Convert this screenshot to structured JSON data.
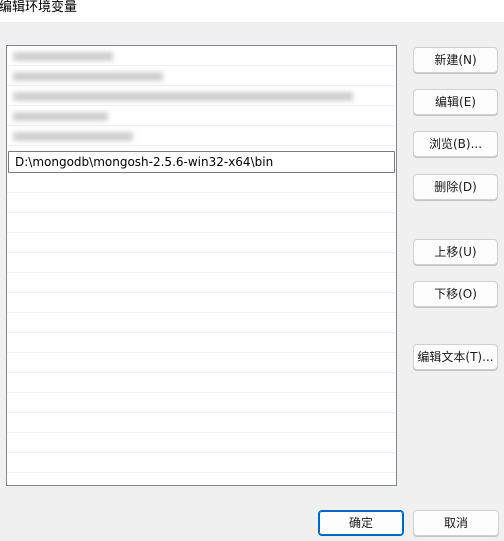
{
  "window": {
    "title": "编辑环境变量"
  },
  "list": {
    "visible_entry": "D:\\mongodb\\mongosh-2.5.6-win32-x64\\bin"
  },
  "buttons": {
    "new": "新建(N)",
    "edit": "编辑(E)",
    "browse": "浏览(B)...",
    "delete": "删除(D)",
    "move_up": "上移(U)",
    "move_down": "下移(O)",
    "edit_text": "编辑文本(T)...",
    "ok": "确定",
    "cancel": "取消"
  },
  "colors": {
    "accent": "#0067c0",
    "dialog_bg": "#f0f0f0",
    "list_bg": "#ffffff"
  }
}
